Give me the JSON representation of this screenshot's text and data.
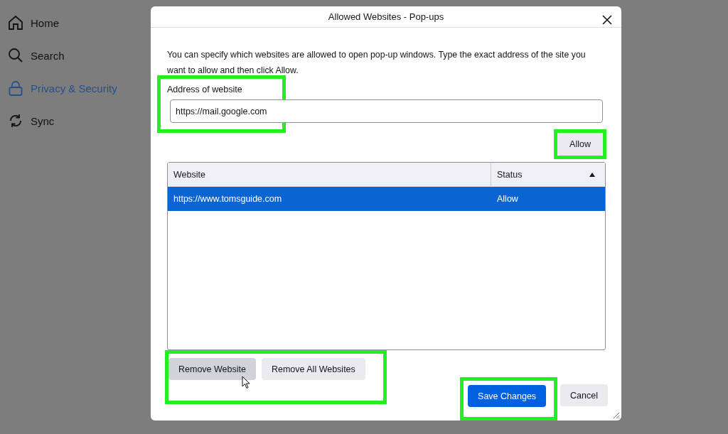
{
  "sidebar": {
    "items": [
      {
        "label": "Home",
        "selected": false
      },
      {
        "label": "Search",
        "selected": false
      },
      {
        "label": "Privacy & Security",
        "selected": true
      },
      {
        "label": "Sync",
        "selected": false
      }
    ]
  },
  "dialog": {
    "title": "Allowed Websites - Pop-ups",
    "description": "You can specify which websites are allowed to open pop-up windows. Type the exact address of the site you want to allow and then click Allow.",
    "address": {
      "label": "Address of website",
      "value": "https://mail.google.com",
      "highlighted": true
    },
    "allow_button": {
      "label": "Allow",
      "highlighted": true
    },
    "table": {
      "columns": [
        {
          "label": "Website",
          "sorted": false
        },
        {
          "label": "Status",
          "sorted": true
        }
      ],
      "rows": [
        {
          "website": "https://www.tomsguide.com",
          "status": "Allow",
          "selected": true
        }
      ]
    },
    "remove_buttons": {
      "highlighted": true,
      "buttons": [
        {
          "label": "Remove Website",
          "hovered": true
        },
        {
          "label": "Remove All Websites",
          "hovered": false
        }
      ]
    },
    "footer_buttons": [
      {
        "label": "Save Changes",
        "kind": "primary",
        "highlighted": true
      },
      {
        "label": "Cancel",
        "kind": "secondary",
        "highlighted": false
      }
    ]
  }
}
